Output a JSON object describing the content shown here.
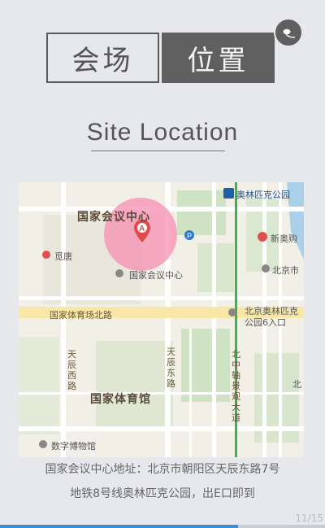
{
  "header": {
    "tab_venue": "会场",
    "tab_location": "位置",
    "subtitle": "Site Location"
  },
  "map": {
    "labels": {
      "venue_big": "国家会议中心",
      "venue_small": "国家会议中心",
      "stadium": "国家体育馆",
      "olympic_station": "奥林匹克公园",
      "xin_ao": "新奥购",
      "beijing_right": "北京市",
      "mideng": "觅唐",
      "road_tiyuchang": "国家体育场北路",
      "road_tianchen_west": "天辰西路",
      "road_tianchen_east": "天辰东路",
      "road_beizhou": "北中轴景观大道",
      "exit_label": "北京奥林匹克公园6入口",
      "museum": "数字博物馆",
      "beijing_edge": "北"
    },
    "colors": {
      "block": "#cfe3c4",
      "road": "#ffffff",
      "main_road": "#f8e7a6",
      "water": "#aacfe9",
      "metro": "#39b54a",
      "marker_halo": "#f48fb1",
      "marker": "#e04a4a"
    }
  },
  "address": {
    "line1": "国家会议中心地址：北京市朝阳区天辰东路7号",
    "line2": "地铁8号线奥林匹克公园，出E口即到"
  },
  "pagination": {
    "page": "11/15",
    "progress": 0.733
  }
}
